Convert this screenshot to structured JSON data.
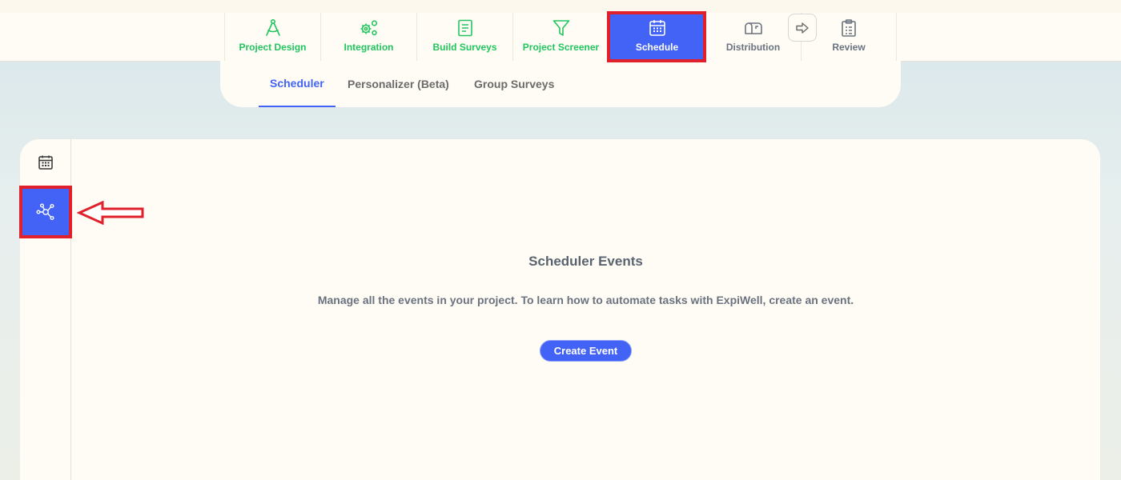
{
  "top_nav": {
    "items": [
      {
        "label": "Project Design",
        "icon": "compass-icon"
      },
      {
        "label": "Integration",
        "icon": "gears-icon"
      },
      {
        "label": "Build Surveys",
        "icon": "document-icon"
      },
      {
        "label": "Project Screener",
        "icon": "filter-icon"
      },
      {
        "label": "Schedule",
        "icon": "calendar-icon",
        "active": true
      },
      {
        "label": "Distribution",
        "icon": "mailbox-icon"
      },
      {
        "label": "Review",
        "icon": "clipboard-icon"
      }
    ],
    "active_color": "#4263f5",
    "accent_color": "#22c55e"
  },
  "sub_tabs": {
    "items": [
      {
        "label": "Scheduler",
        "active": true
      },
      {
        "label": "Personalizer (Beta)"
      },
      {
        "label": "Group Surveys"
      }
    ]
  },
  "side_rail": {
    "items": [
      {
        "icon": "calendar-icon"
      },
      {
        "icon": "network-icon",
        "active": true
      }
    ]
  },
  "main": {
    "title": "Scheduler Events",
    "description": "Manage all the events in your project. To learn how to automate tasks with ExpiWell, create an event.",
    "create_button": "Create Event"
  },
  "annotation_color": "#e0202a"
}
